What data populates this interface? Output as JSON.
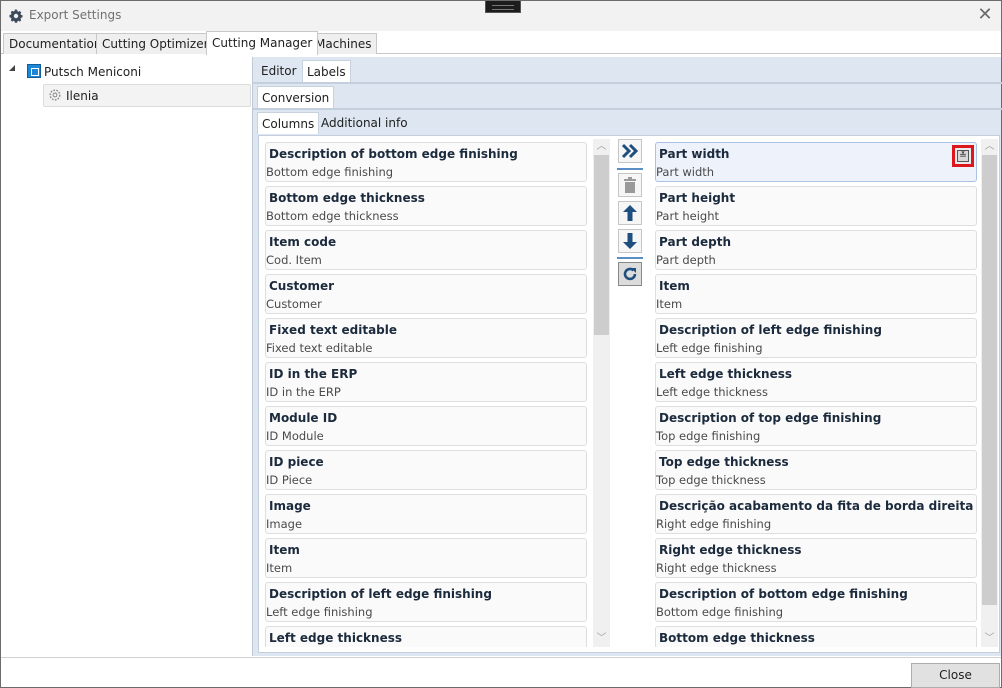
{
  "window": {
    "title": "Export Settings",
    "close_glyph": "✕"
  },
  "top_tabs": [
    {
      "label": "Documentation",
      "active": false
    },
    {
      "label": "Cutting Optimizers",
      "active": false
    },
    {
      "label": "Cutting Manager",
      "active": true
    },
    {
      "label": "Machines",
      "active": false
    }
  ],
  "tree": {
    "root": {
      "label": "Putsch Meniconi",
      "icon": "machine-icon",
      "expanded": true
    },
    "child": {
      "label": "Ilenia",
      "icon": "gear-icon",
      "selected": true
    }
  },
  "subtabs_level1": [
    {
      "label": "Editor",
      "active": false
    },
    {
      "label": "Labels",
      "active": true
    }
  ],
  "subtabs_level2": [
    {
      "label": "Conversion",
      "active": true
    }
  ],
  "subtabs_level3": [
    {
      "label": "Columns",
      "active": true
    },
    {
      "label": "Additional info",
      "active": false
    }
  ],
  "available_columns": [
    {
      "title": "Description of bottom edge finishing",
      "subtitle": "Bottom edge finishing"
    },
    {
      "title": "Bottom edge thickness",
      "subtitle": "Bottom edge thickness"
    },
    {
      "title": "Item code",
      "subtitle": "Cod. Item"
    },
    {
      "title": "Customer",
      "subtitle": "Customer"
    },
    {
      "title": "Fixed text editable",
      "subtitle": "Fixed text editable"
    },
    {
      "title": "ID in the ERP",
      "subtitle": "ID in the ERP"
    },
    {
      "title": "Module ID",
      "subtitle": "ID Module"
    },
    {
      "title": "ID piece",
      "subtitle": "ID Piece"
    },
    {
      "title": "Image",
      "subtitle": "Image"
    },
    {
      "title": "Item",
      "subtitle": "Item"
    },
    {
      "title": "Description of left edge finishing",
      "subtitle": "Left edge finishing"
    },
    {
      "title": "Left edge thickness",
      "subtitle": ""
    }
  ],
  "selected_columns": [
    {
      "title": "Part width",
      "subtitle": "Part width",
      "selected": true
    },
    {
      "title": "Part height",
      "subtitle": "Part height"
    },
    {
      "title": "Part depth",
      "subtitle": "Part depth"
    },
    {
      "title": "Item",
      "subtitle": "Item"
    },
    {
      "title": "Description of left edge finishing",
      "subtitle": "Left edge finishing"
    },
    {
      "title": "Left edge thickness",
      "subtitle": "Left edge thickness"
    },
    {
      "title": "Description of top edge finishing",
      "subtitle": "Top edge finishing"
    },
    {
      "title": "Top edge thickness",
      "subtitle": "Top edge thickness"
    },
    {
      "title": "Descrição acabamento da fita de borda direita",
      "subtitle": "Right edge finishing"
    },
    {
      "title": "Right edge thickness",
      "subtitle": "Right edge thickness"
    },
    {
      "title": "Description of bottom edge finishing",
      "subtitle": "Bottom edge finishing"
    },
    {
      "title": "Bottom edge thickness",
      "subtitle": ""
    }
  ],
  "actions": [
    {
      "name": "add-all",
      "icon": "double-chevron-right-icon"
    },
    {
      "name": "delete",
      "icon": "trash-icon",
      "disabled": true
    },
    {
      "name": "move-up",
      "icon": "arrow-up-icon"
    },
    {
      "name": "move-down",
      "icon": "arrow-down-icon"
    },
    {
      "name": "reset",
      "icon": "refresh-icon"
    }
  ],
  "scroll": {
    "left_position": 0.0,
    "right_position": 0.0
  },
  "colors": {
    "accent": "#1f4f7f",
    "highlight_box": "#e0161e",
    "pane_bg": "#dde6f1"
  },
  "footer": {
    "close_label": "Close"
  }
}
